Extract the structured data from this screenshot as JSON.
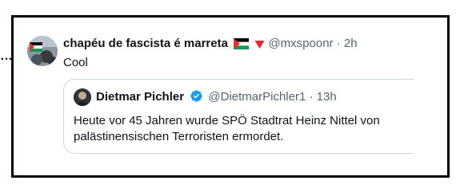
{
  "overflow_menu_glyph": "…",
  "tweet": {
    "author_name": "chapéu de fascista é marreta",
    "emoji_icons": [
      "palestine-flag-icon",
      "red-triangle-icon"
    ],
    "handle": "@mxspoonr",
    "separator": "·",
    "time": "2h",
    "text": "Cool"
  },
  "quoted_tweet": {
    "author_name": "Dietmar Pichler",
    "verified_icon": "verified-badge-icon",
    "handle": "@DietmarPichler1",
    "separator": "·",
    "time": "13h",
    "text": "Heute vor 45 Jahren wurde SPÖ Stadtrat Heinz Nittel von palästinensischen Terroristen ermordet."
  },
  "colors": {
    "frame_border": "#000000",
    "text_primary": "#0f1419",
    "text_secondary": "#536471",
    "quote_border": "#cfd9de",
    "verified_blue": "#1d9bf0",
    "triangle_red": "#f4212e"
  }
}
